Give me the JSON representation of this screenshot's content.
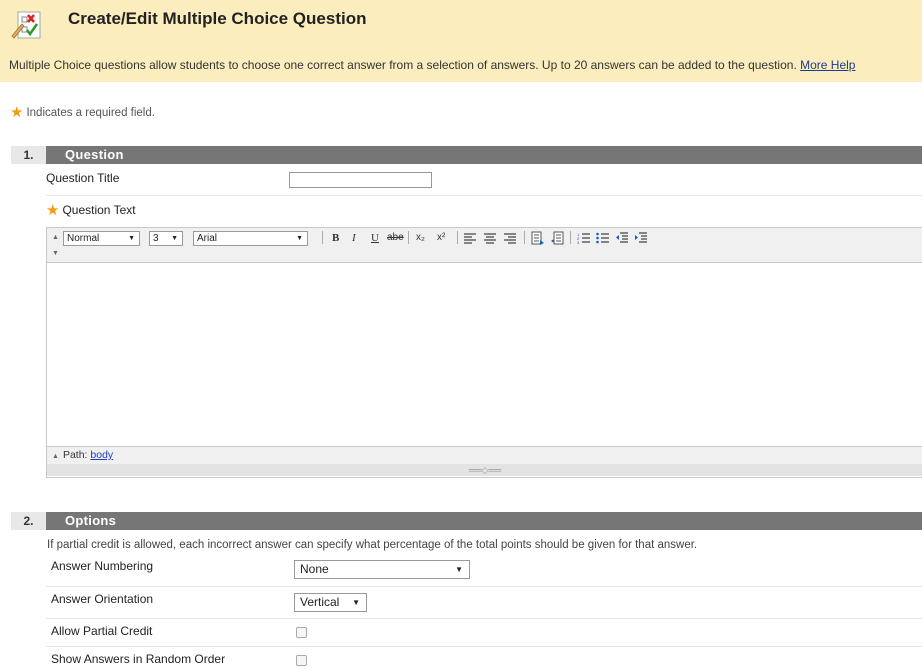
{
  "header": {
    "title": "Create/Edit Multiple Choice Question",
    "description": "Multiple Choice questions allow students to choose one correct answer from a selection of answers. Up to 20 answers can be added to the question.",
    "help_link": "More Help"
  },
  "required_note": "Indicates a required field.",
  "sections": [
    {
      "number": "1.",
      "title": "Question"
    },
    {
      "number": "2.",
      "title": "Options"
    }
  ],
  "question": {
    "title_label": "Question Title",
    "title_value": "",
    "text_label": "Question Text"
  },
  "editor": {
    "format_select": "Normal",
    "size_select": "3",
    "font_select": "Arial",
    "buttons": {
      "bold": "B",
      "italic": "I",
      "underline": "U",
      "strike": "abe",
      "subscript": "x₂",
      "superscript": "x²"
    },
    "path_label": "Path:",
    "path_value": "body",
    "resize_handle": "══◇══"
  },
  "options": {
    "description": "If partial credit is allowed, each incorrect answer can specify what percentage of the total points should be given for that answer.",
    "answer_numbering_label": "Answer Numbering",
    "answer_numbering_value": "None",
    "answer_orientation_label": "Answer Orientation",
    "answer_orientation_value": "Vertical",
    "partial_credit_label": "Allow Partial Credit",
    "partial_credit_checked": false,
    "random_order_label": "Show Answers in Random Order",
    "random_order_checked": false
  },
  "colors": {
    "header_bg": "#fcedbe",
    "section_bar": "#767676",
    "required_star": "#f39c12",
    "link": "#1a3d8f"
  }
}
